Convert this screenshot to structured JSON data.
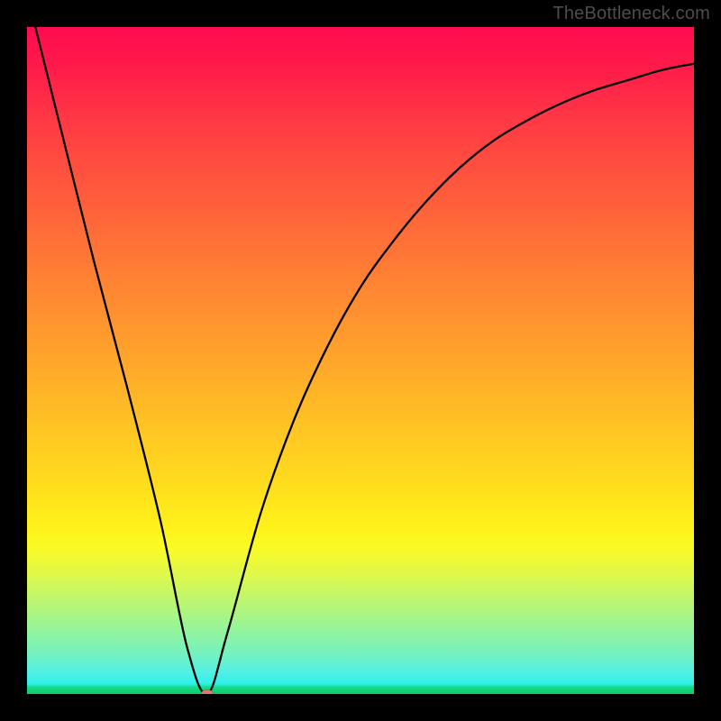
{
  "attribution": "TheBottleneck.com",
  "chart_data": {
    "type": "line",
    "title": "",
    "xlabel": "",
    "ylabel": "",
    "xlim": [
      0,
      100
    ],
    "ylim": [
      0,
      100
    ],
    "grid": false,
    "legend": false,
    "series": [
      {
        "name": "curve",
        "x": [
          0,
          5,
          10,
          15,
          20,
          24,
          27,
          30,
          35,
          40,
          45,
          50,
          55,
          60,
          65,
          70,
          75,
          80,
          85,
          90,
          95,
          100
        ],
        "y": [
          105,
          85,
          65,
          46,
          26,
          7,
          0,
          9,
          27,
          41,
          52,
          61,
          68,
          74,
          79,
          83,
          86,
          88.5,
          90.5,
          92,
          93.5,
          94.5
        ]
      }
    ],
    "marker": {
      "x": 27,
      "y": 0,
      "name": "minimum-point"
    },
    "background_gradient": {
      "stops": [
        {
          "pos": 0,
          "color": "#ff0b50"
        },
        {
          "pos": 50,
          "color": "#ffa02c"
        },
        {
          "pos": 75,
          "color": "#fff11a"
        },
        {
          "pos": 100,
          "color": "#0ad05a"
        }
      ]
    }
  }
}
